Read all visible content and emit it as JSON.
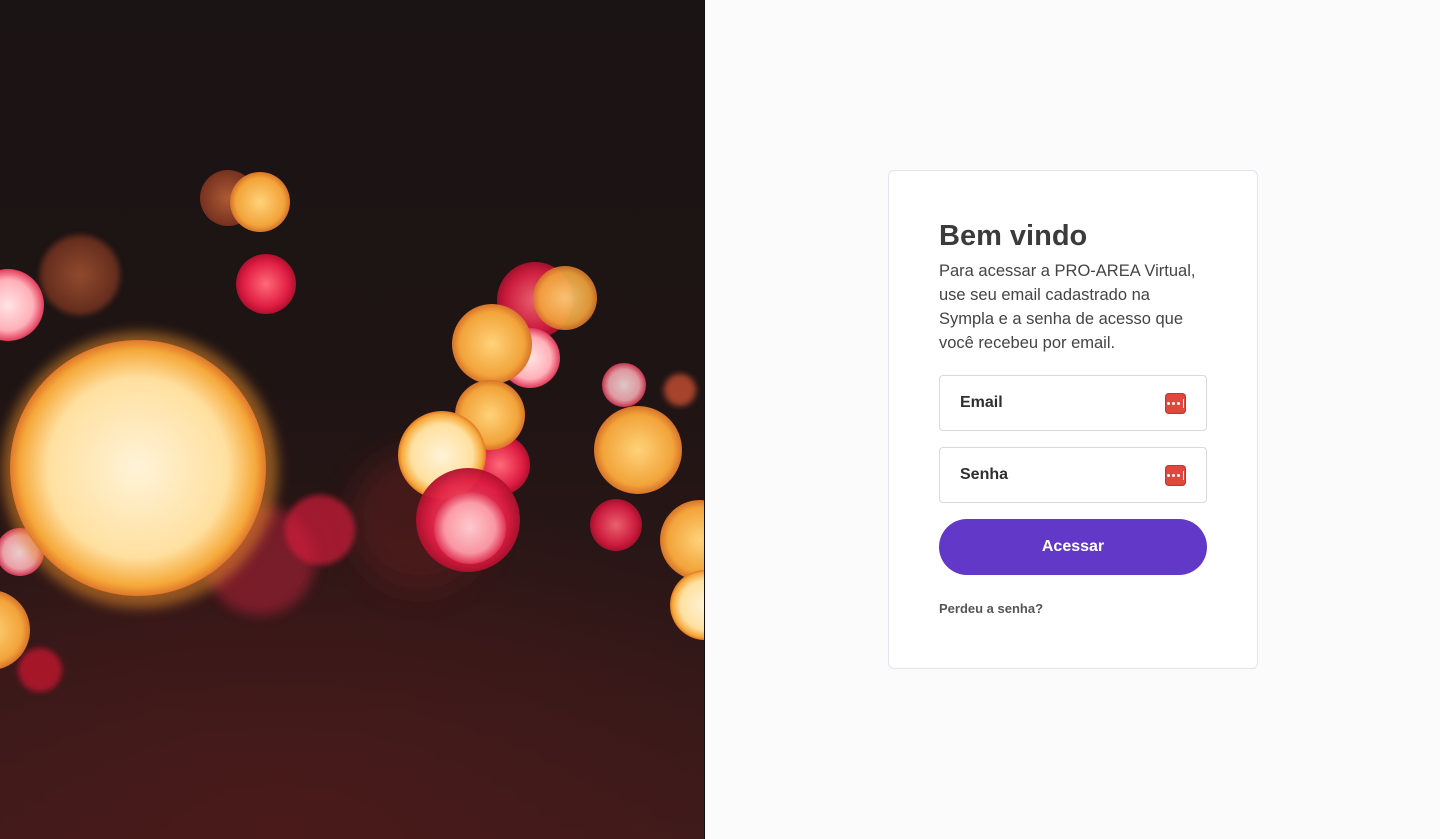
{
  "hero": {
    "image": "bokeh-lights-photo"
  },
  "login": {
    "title": "Bem vindo",
    "subtitle": "Para acessar a PRO-AREA Virtual, use seu email cadastrado na Sympla e a senha de acesso que você recebeu por email.",
    "email_label": "Email",
    "password_label": "Senha",
    "submit_label": "Acessar",
    "forgot_label": "Perdeu a senha?"
  },
  "colors": {
    "accent": "#6238c8",
    "password_manager_icon": "#e0473f",
    "card_border": "#e6e1f3",
    "page_background": "#fbfbfc"
  },
  "icons": {
    "field_autofill": "password-manager-icon"
  }
}
